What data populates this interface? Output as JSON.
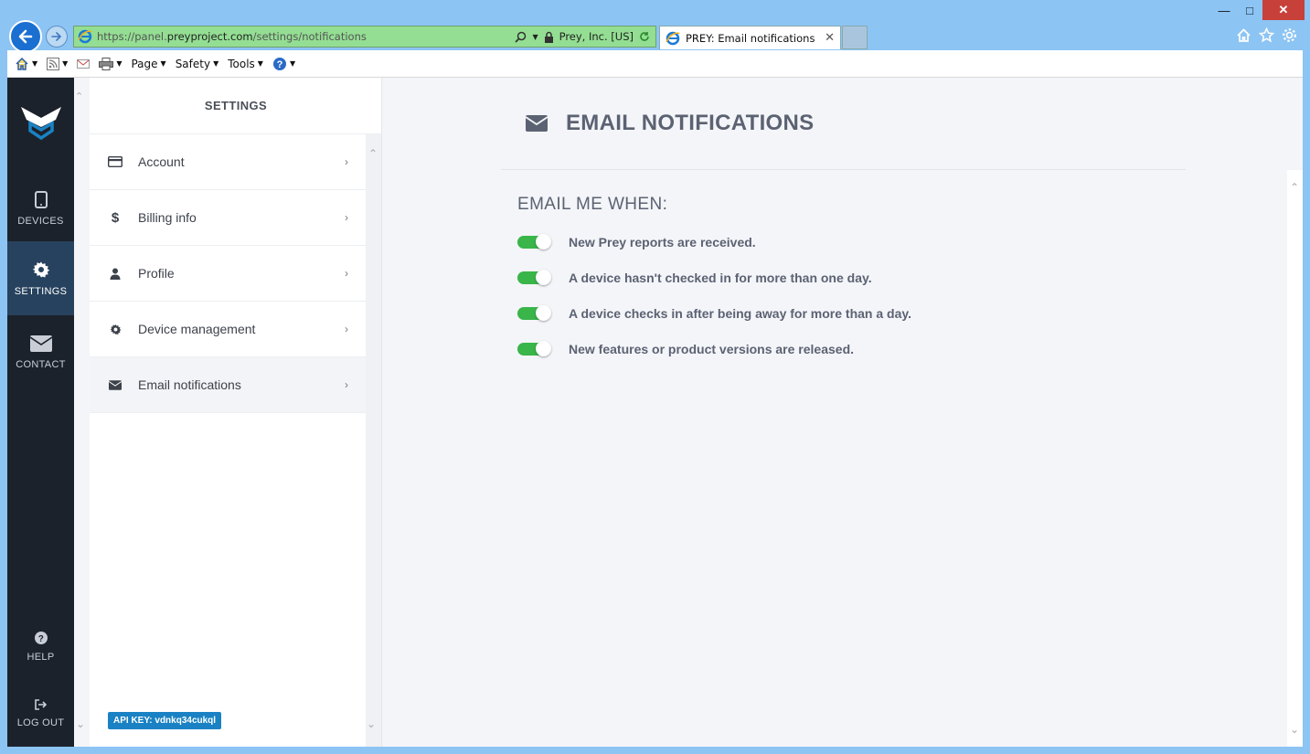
{
  "browser": {
    "url_prefix": "https://panel.",
    "url_host": "preyproject.com",
    "url_path": "/settings/notifications",
    "site_identity": "Prey, Inc. [US]",
    "tab_title": "PREY: Email notifications"
  },
  "commandbar": {
    "page": "Page",
    "safety": "Safety",
    "tools": "Tools"
  },
  "leftnav": {
    "devices": "DEVICES",
    "settings": "SETTINGS",
    "contact": "CONTACT",
    "help": "HELP",
    "logout": "LOG OUT"
  },
  "settings": {
    "title": "SETTINGS",
    "items": [
      {
        "label": "Account"
      },
      {
        "label": "Billing info"
      },
      {
        "label": "Profile"
      },
      {
        "label": "Device management"
      },
      {
        "label": "Email notifications"
      }
    ],
    "api_key": "API KEY: vdnkq34cukql"
  },
  "main": {
    "title": "EMAIL NOTIFICATIONS",
    "subtitle": "EMAIL ME WHEN:",
    "options": [
      {
        "label": "New Prey reports are received.",
        "enabled": true
      },
      {
        "label": "A device hasn't checked in for more than one day.",
        "enabled": true
      },
      {
        "label": "A device checks in after being away for more than a day.",
        "enabled": true
      },
      {
        "label": "New features or product versions are released.",
        "enabled": true
      }
    ]
  },
  "colors": {
    "toggle_on": "#39b54a",
    "nav_bg": "#1c222b",
    "nav_active": "#27425e",
    "api_key_bg": "#1a82c4"
  }
}
